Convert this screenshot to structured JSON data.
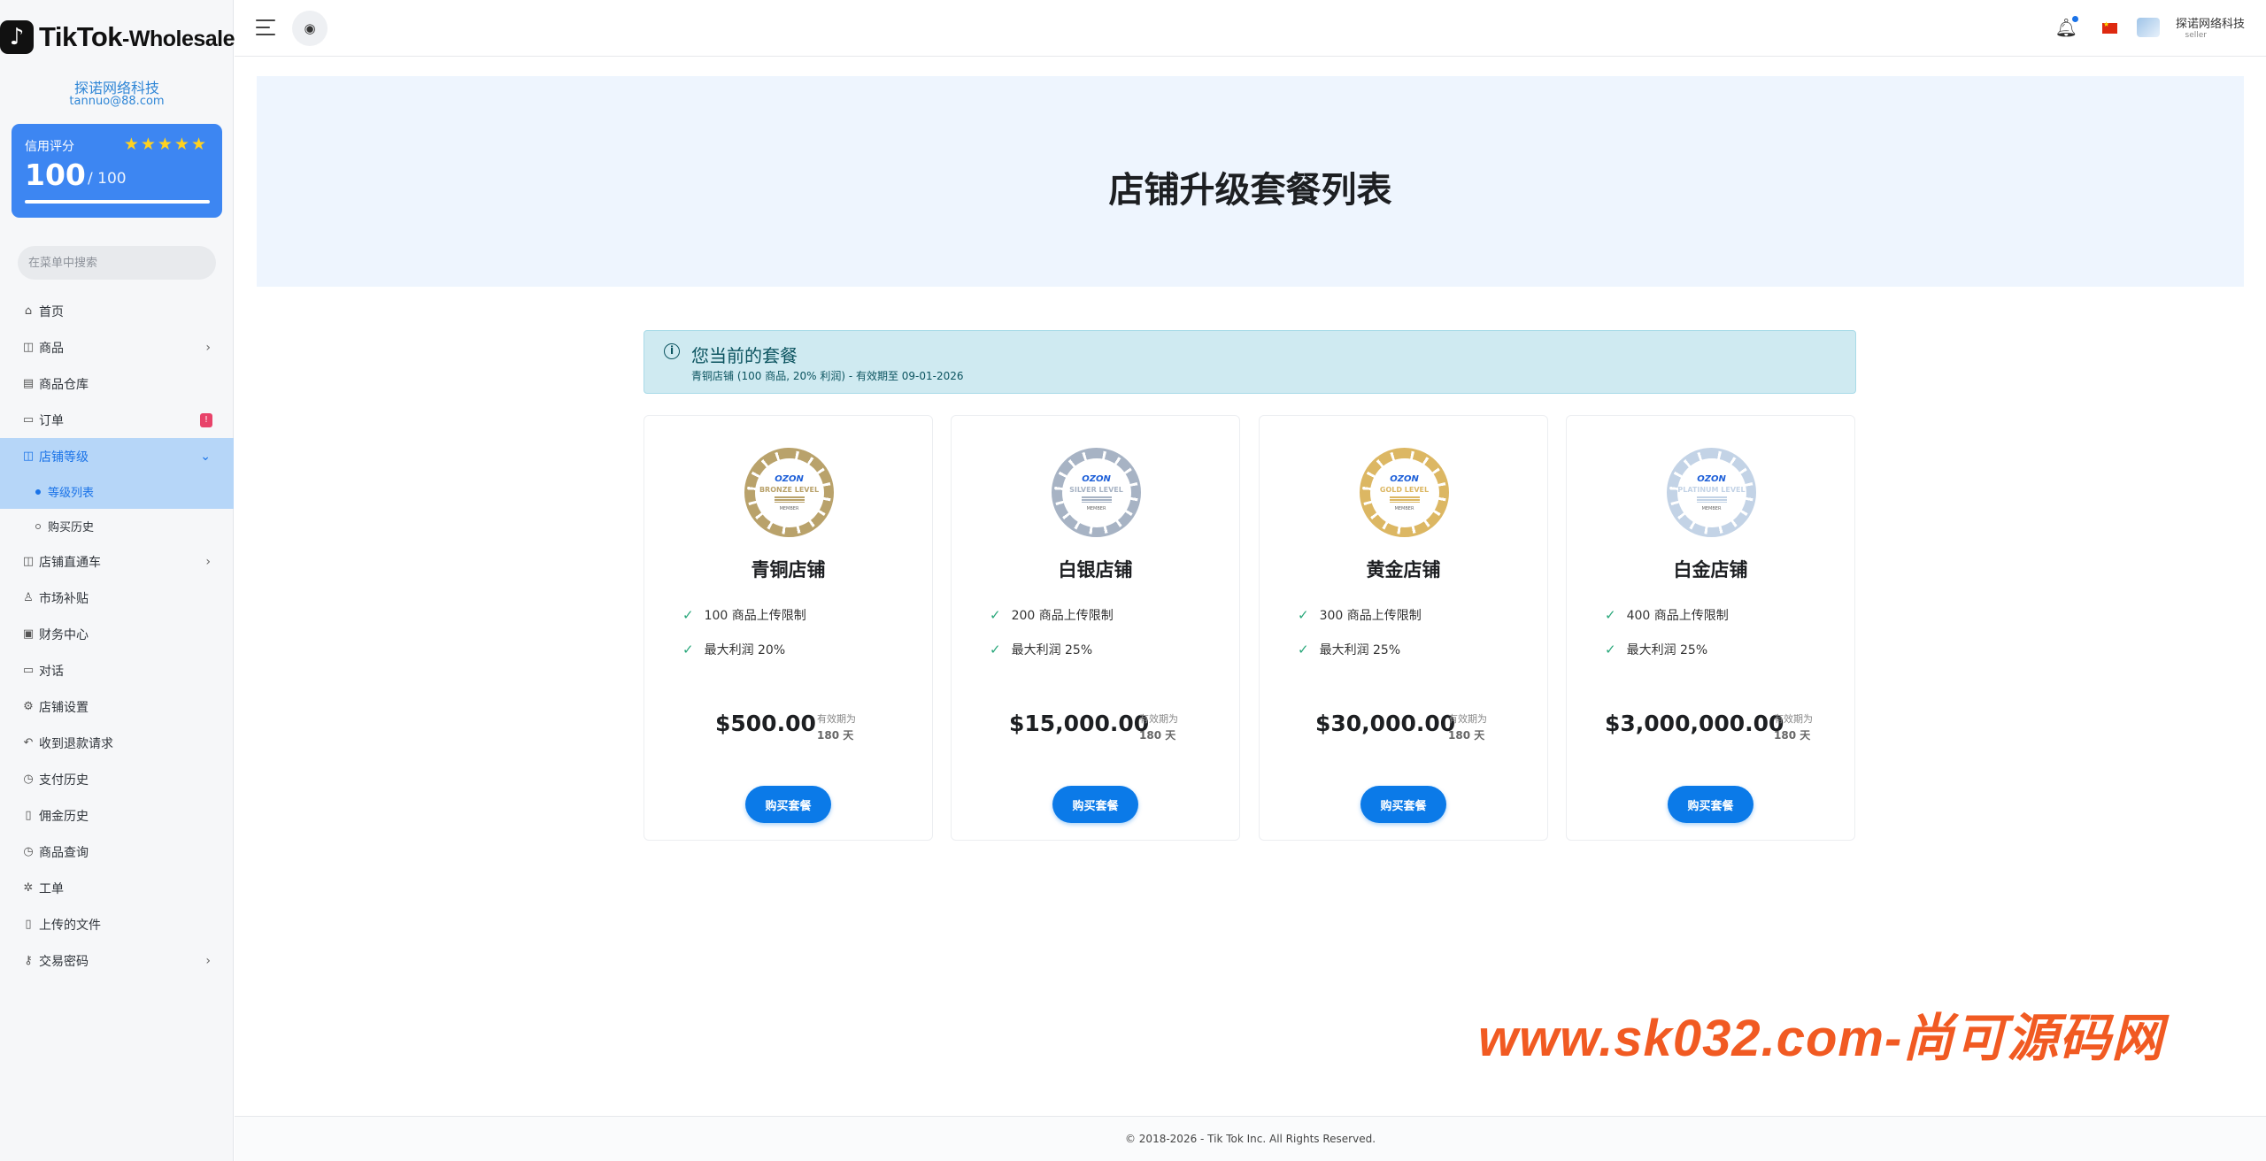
{
  "sidebar": {
    "logo_text": "TikTok",
    "logo_sub": "-Wholesale",
    "profile_name": "探诺网络科技",
    "profile_email": "tannuo@88.com",
    "credit_label": "信用评分",
    "credit_stars": 5,
    "credit_score": "100",
    "credit_max": "/ 100",
    "search_placeholder": "在菜单中搜索",
    "menu": [
      {
        "label": "首页",
        "icon": "home-icon"
      },
      {
        "label": "商品",
        "icon": "bag-icon",
        "chevron": true
      },
      {
        "label": "商品仓库",
        "icon": "warehouse-icon"
      },
      {
        "label": "订单",
        "icon": "order-icon",
        "badge": "!"
      },
      {
        "label": "店铺等级",
        "icon": "store-icon",
        "active": true,
        "expanded": true
      },
      {
        "label": "等级列表",
        "sub": true,
        "active": true
      },
      {
        "label": "购买历史",
        "sub": true
      },
      {
        "label": "店铺直通车",
        "icon": "bag-icon",
        "chevron": true
      },
      {
        "label": "市场补贴",
        "icon": "user-icon"
      },
      {
        "label": "财务中心",
        "icon": "wallet-icon"
      },
      {
        "label": "对话",
        "icon": "chat-icon"
      },
      {
        "label": "店铺设置",
        "icon": "gear-icon"
      },
      {
        "label": "收到退款请求",
        "icon": "refund-icon"
      },
      {
        "label": "支付历史",
        "icon": "history-icon"
      },
      {
        "label": "佣金历史",
        "icon": "document-icon"
      },
      {
        "label": "商品查询",
        "icon": "query-icon"
      },
      {
        "label": "工单",
        "icon": "ticket-icon"
      },
      {
        "label": "上传的文件",
        "icon": "file-icon"
      },
      {
        "label": "交易密码",
        "icon": "key-icon",
        "chevron": true
      }
    ]
  },
  "header": {
    "user_name": "探诺网络科技",
    "user_role": "seller",
    "notification_dot_color": "#1a73e8"
  },
  "main": {
    "title": "店铺升级套餐列表",
    "current_plan": {
      "title": "您当前的套餐",
      "description": "青铜店铺 (100 商品, 20% 利润) - 有效期至 09-01-2026"
    },
    "valid_label": "有效期为",
    "buy_label": "购买套餐",
    "plans": [
      {
        "name": "青铜店铺",
        "level": "BRONZE LEVEL",
        "feature1": "100 商品上传限制",
        "feature2": "最大利润 20%",
        "price": "$500.00",
        "days": "180 天",
        "color": "#b9a26b"
      },
      {
        "name": "白银店铺",
        "level": "SILVER LEVEL",
        "feature1": "200 商品上传限制",
        "feature2": "最大利润 25%",
        "price": "$15,000.00",
        "days": "180 天",
        "color": "#a7b3c4"
      },
      {
        "name": "黄金店铺",
        "level": "GOLD LEVEL",
        "feature1": "300 商品上传限制",
        "feature2": "最大利润 25%",
        "price": "$30,000.00",
        "days": "180 天",
        "color": "#dcb763"
      },
      {
        "name": "白金店铺",
        "level": "PLATINUM LEVEL",
        "feature1": "400 商品上传限制",
        "feature2": "最大利润 25%",
        "price": "$3,000,000.00",
        "days": "180 天",
        "color": "#c3d3e6"
      }
    ],
    "medal_brand": "OZON",
    "medal_member": "MEMBER"
  },
  "watermark": "www.sk032.com-尚可源码网",
  "footer": "© 2018-2026 - Tik Tok Inc. All Rights Reserved."
}
